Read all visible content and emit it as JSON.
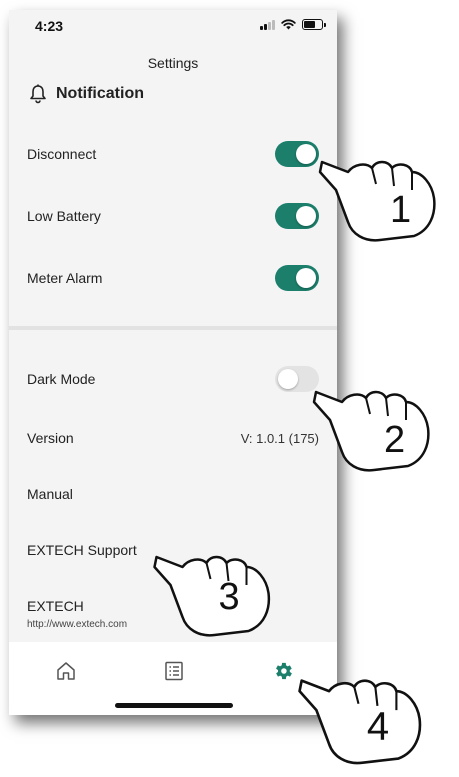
{
  "status_bar": {
    "time": "4:23"
  },
  "header": {
    "title": "Settings"
  },
  "notification": {
    "section_title": "Notification",
    "items": [
      {
        "label": "Disconnect",
        "enabled": true
      },
      {
        "label": "Low Battery",
        "enabled": true
      },
      {
        "label": "Meter Alarm",
        "enabled": true
      }
    ]
  },
  "general": {
    "dark_mode": {
      "label": "Dark Mode",
      "enabled": false
    },
    "version": {
      "label": "Version",
      "value": "V: 1.0.1 (175)"
    },
    "manual": {
      "label": "Manual"
    },
    "support": {
      "label": "EXTECH Support"
    },
    "extech": {
      "label": "EXTECH",
      "url": "http://www.extech.com"
    }
  },
  "tab_bar": {
    "tabs": [
      {
        "icon": "home-icon",
        "active": false
      },
      {
        "icon": "list-icon",
        "active": false
      },
      {
        "icon": "gear-icon",
        "active": true
      }
    ]
  },
  "callouts": [
    "1",
    "2",
    "3",
    "4"
  ],
  "colors": {
    "accent": "#1b7f6b",
    "toggle_off": "#e3e3e3",
    "background": "#f4f4f4"
  }
}
